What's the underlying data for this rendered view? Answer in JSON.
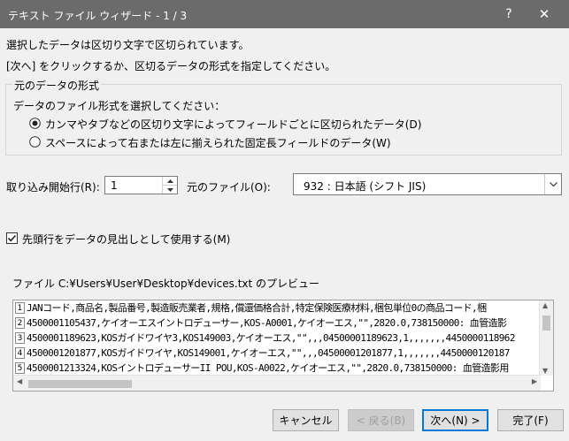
{
  "window": {
    "title": "テキスト ファイル ウィザード - 1 / 3",
    "help_label": "?",
    "close_label": "✕"
  },
  "intro": {
    "line1": "選択したデータは区切り文字で区切られています。",
    "line2": "[次へ] をクリックするか、区切るデータの形式を指定してください。"
  },
  "format_group": {
    "legend": "元のデータの形式",
    "prompt": "データのファイル形式を選択してください：",
    "options": [
      {
        "label": "カンマやタブなどの区切り文字によってフィールドごとに区切られたデータ(D)",
        "selected": true
      },
      {
        "label": "スペースによって右または左に揃えられた固定長フィールドのデータ(W)",
        "selected": false
      }
    ]
  },
  "start_row": {
    "label": "取り込み開始行(R):",
    "value": "1"
  },
  "origin": {
    "label": "元のファイル(O):",
    "value": "932 : 日本語 (シフト JIS)"
  },
  "header_checkbox": {
    "label": "先頭行をデータの見出しとして使用する(M)",
    "checked": true
  },
  "preview": {
    "label": "ファイル C:¥Users¥User¥Desktop¥devices.txt のプレビュー",
    "row_numbers": [
      "1",
      "2",
      "3",
      "4",
      "5"
    ],
    "rows": [
      "JANコード,商品名,製品番号,製造販売業者,規格,償還価格合計,特定保険医療材料,梱包単位0の商品コード,梱",
      "4500001105437,ケイオーエスイントロデューサー,KOS-A0001,ケイオーエス,\"\",2820.0,738150000: 血管造影",
      "4500001189623,KOSガイドワイヤ3,KOS149003,ケイオーエス,\"\",,,04500001189623,1,,,,,,,4450000118962",
      "4500001201877,KOSガイドワイヤ,KOS149001,ケイオーエス,\"\",,,04500001201877,1,,,,,,,4450000120187",
      "4500001213324,KOSイントロデューサーII POU,KOS-A0022,ケイオーエス,\"\",2820.0,738150000: 血管造影用"
    ]
  },
  "buttons": {
    "cancel": "キャンセル",
    "back": "< 戻る(B)",
    "next": "次へ(N) >",
    "finish": "完了(F)"
  },
  "colors": {
    "titlebar": "#6b6b6b",
    "accent": "#0078d7",
    "dialog_bg": "#f0f0f0"
  }
}
